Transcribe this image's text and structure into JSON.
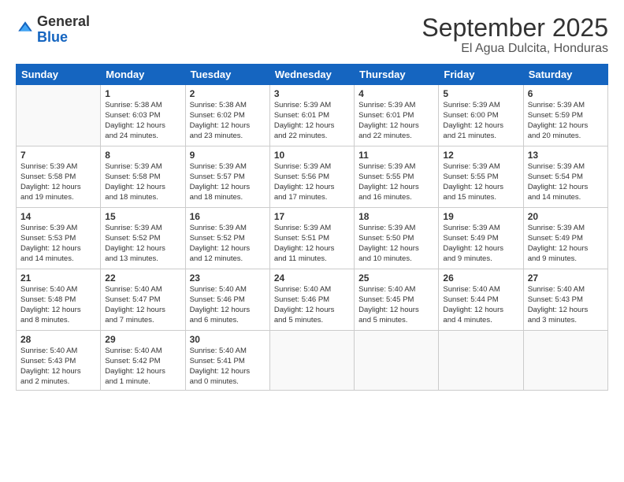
{
  "logo": {
    "general": "General",
    "blue": "Blue"
  },
  "title": "September 2025",
  "subtitle": "El Agua Dulcita, Honduras",
  "days": [
    "Sunday",
    "Monday",
    "Tuesday",
    "Wednesday",
    "Thursday",
    "Friday",
    "Saturday"
  ],
  "weeks": [
    [
      {
        "num": "",
        "info": ""
      },
      {
        "num": "1",
        "info": "Sunrise: 5:38 AM\nSunset: 6:03 PM\nDaylight: 12 hours\nand 24 minutes."
      },
      {
        "num": "2",
        "info": "Sunrise: 5:38 AM\nSunset: 6:02 PM\nDaylight: 12 hours\nand 23 minutes."
      },
      {
        "num": "3",
        "info": "Sunrise: 5:39 AM\nSunset: 6:01 PM\nDaylight: 12 hours\nand 22 minutes."
      },
      {
        "num": "4",
        "info": "Sunrise: 5:39 AM\nSunset: 6:01 PM\nDaylight: 12 hours\nand 22 minutes."
      },
      {
        "num": "5",
        "info": "Sunrise: 5:39 AM\nSunset: 6:00 PM\nDaylight: 12 hours\nand 21 minutes."
      },
      {
        "num": "6",
        "info": "Sunrise: 5:39 AM\nSunset: 5:59 PM\nDaylight: 12 hours\nand 20 minutes."
      }
    ],
    [
      {
        "num": "7",
        "info": "Sunrise: 5:39 AM\nSunset: 5:58 PM\nDaylight: 12 hours\nand 19 minutes."
      },
      {
        "num": "8",
        "info": "Sunrise: 5:39 AM\nSunset: 5:58 PM\nDaylight: 12 hours\nand 18 minutes."
      },
      {
        "num": "9",
        "info": "Sunrise: 5:39 AM\nSunset: 5:57 PM\nDaylight: 12 hours\nand 18 minutes."
      },
      {
        "num": "10",
        "info": "Sunrise: 5:39 AM\nSunset: 5:56 PM\nDaylight: 12 hours\nand 17 minutes."
      },
      {
        "num": "11",
        "info": "Sunrise: 5:39 AM\nSunset: 5:55 PM\nDaylight: 12 hours\nand 16 minutes."
      },
      {
        "num": "12",
        "info": "Sunrise: 5:39 AM\nSunset: 5:55 PM\nDaylight: 12 hours\nand 15 minutes."
      },
      {
        "num": "13",
        "info": "Sunrise: 5:39 AM\nSunset: 5:54 PM\nDaylight: 12 hours\nand 14 minutes."
      }
    ],
    [
      {
        "num": "14",
        "info": "Sunrise: 5:39 AM\nSunset: 5:53 PM\nDaylight: 12 hours\nand 14 minutes."
      },
      {
        "num": "15",
        "info": "Sunrise: 5:39 AM\nSunset: 5:52 PM\nDaylight: 12 hours\nand 13 minutes."
      },
      {
        "num": "16",
        "info": "Sunrise: 5:39 AM\nSunset: 5:52 PM\nDaylight: 12 hours\nand 12 minutes."
      },
      {
        "num": "17",
        "info": "Sunrise: 5:39 AM\nSunset: 5:51 PM\nDaylight: 12 hours\nand 11 minutes."
      },
      {
        "num": "18",
        "info": "Sunrise: 5:39 AM\nSunset: 5:50 PM\nDaylight: 12 hours\nand 10 minutes."
      },
      {
        "num": "19",
        "info": "Sunrise: 5:39 AM\nSunset: 5:49 PM\nDaylight: 12 hours\nand 9 minutes."
      },
      {
        "num": "20",
        "info": "Sunrise: 5:39 AM\nSunset: 5:49 PM\nDaylight: 12 hours\nand 9 minutes."
      }
    ],
    [
      {
        "num": "21",
        "info": "Sunrise: 5:40 AM\nSunset: 5:48 PM\nDaylight: 12 hours\nand 8 minutes."
      },
      {
        "num": "22",
        "info": "Sunrise: 5:40 AM\nSunset: 5:47 PM\nDaylight: 12 hours\nand 7 minutes."
      },
      {
        "num": "23",
        "info": "Sunrise: 5:40 AM\nSunset: 5:46 PM\nDaylight: 12 hours\nand 6 minutes."
      },
      {
        "num": "24",
        "info": "Sunrise: 5:40 AM\nSunset: 5:46 PM\nDaylight: 12 hours\nand 5 minutes."
      },
      {
        "num": "25",
        "info": "Sunrise: 5:40 AM\nSunset: 5:45 PM\nDaylight: 12 hours\nand 5 minutes."
      },
      {
        "num": "26",
        "info": "Sunrise: 5:40 AM\nSunset: 5:44 PM\nDaylight: 12 hours\nand 4 minutes."
      },
      {
        "num": "27",
        "info": "Sunrise: 5:40 AM\nSunset: 5:43 PM\nDaylight: 12 hours\nand 3 minutes."
      }
    ],
    [
      {
        "num": "28",
        "info": "Sunrise: 5:40 AM\nSunset: 5:43 PM\nDaylight: 12 hours\nand 2 minutes."
      },
      {
        "num": "29",
        "info": "Sunrise: 5:40 AM\nSunset: 5:42 PM\nDaylight: 12 hours\nand 1 minute."
      },
      {
        "num": "30",
        "info": "Sunrise: 5:40 AM\nSunset: 5:41 PM\nDaylight: 12 hours\nand 0 minutes."
      },
      {
        "num": "",
        "info": ""
      },
      {
        "num": "",
        "info": ""
      },
      {
        "num": "",
        "info": ""
      },
      {
        "num": "",
        "info": ""
      }
    ]
  ]
}
